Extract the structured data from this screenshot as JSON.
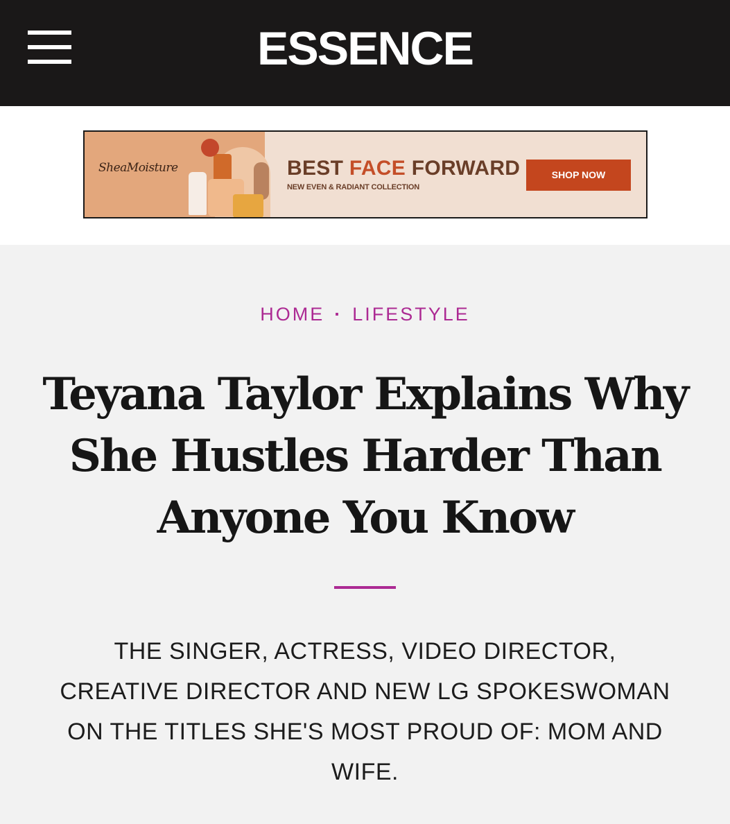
{
  "header": {
    "logo": "ESSENCE"
  },
  "ad": {
    "brand": "SheaMoisture",
    "headline_part1": "BEST ",
    "headline_accent": "FACE",
    "headline_part2": " FORWARD",
    "subline": "NEW EVEN & RADIANT COLLECTION",
    "cta": "SHOP NOW",
    "accent_color": "#c4461e"
  },
  "breadcrumb": {
    "home": "HOME",
    "separator": "·",
    "section": "LIFESTYLE",
    "color": "#ac2a93"
  },
  "article": {
    "title": "Teyana Taylor Explains Why She Hustles Harder Than Anyone You Know",
    "dek": "THE SINGER, ACTRESS, VIDEO DIRECTOR, CREATIVE DIRECTOR AND NEW LG SPOKESWOMAN ON THE TITLES SHE'S MOST PROUD OF: MOM AND WIFE."
  }
}
